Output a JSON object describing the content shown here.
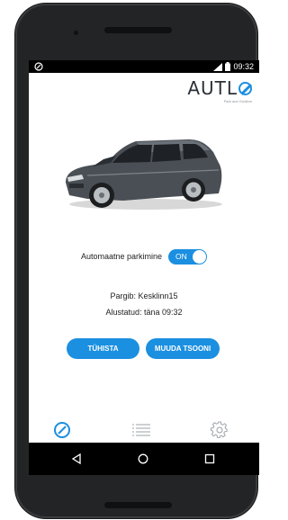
{
  "status_bar": {
    "time": "09:32",
    "left_icon": "compass-status-icon",
    "right_icons": [
      "signal-icon",
      "battery-icon"
    ]
  },
  "logo": {
    "text_prefix": "AUTL",
    "tagline": "Park and Go/ahm"
  },
  "car_image": "car-photo",
  "auto_parking": {
    "label": "Automaatne parkimine",
    "toggle_label": "ON",
    "enabled": true
  },
  "parking_info": {
    "location": "Pargib: Kesklinn15",
    "started": "Alustatud: täna 09:32"
  },
  "buttons": {
    "cancel": "TÜHISTA",
    "change_zone": "MUUDA TSOONI"
  },
  "tabs": [
    {
      "name": "compass",
      "icon": "compass-icon",
      "active": true
    },
    {
      "name": "list",
      "icon": "list-icon",
      "active": false
    },
    {
      "name": "settings",
      "icon": "gear-icon",
      "active": false
    }
  ],
  "nav": [
    "back-icon",
    "home-icon",
    "recents-icon"
  ],
  "colors": {
    "accent": "#1b8fe0",
    "statusbar": "#000000",
    "phone_body": "#222426"
  }
}
